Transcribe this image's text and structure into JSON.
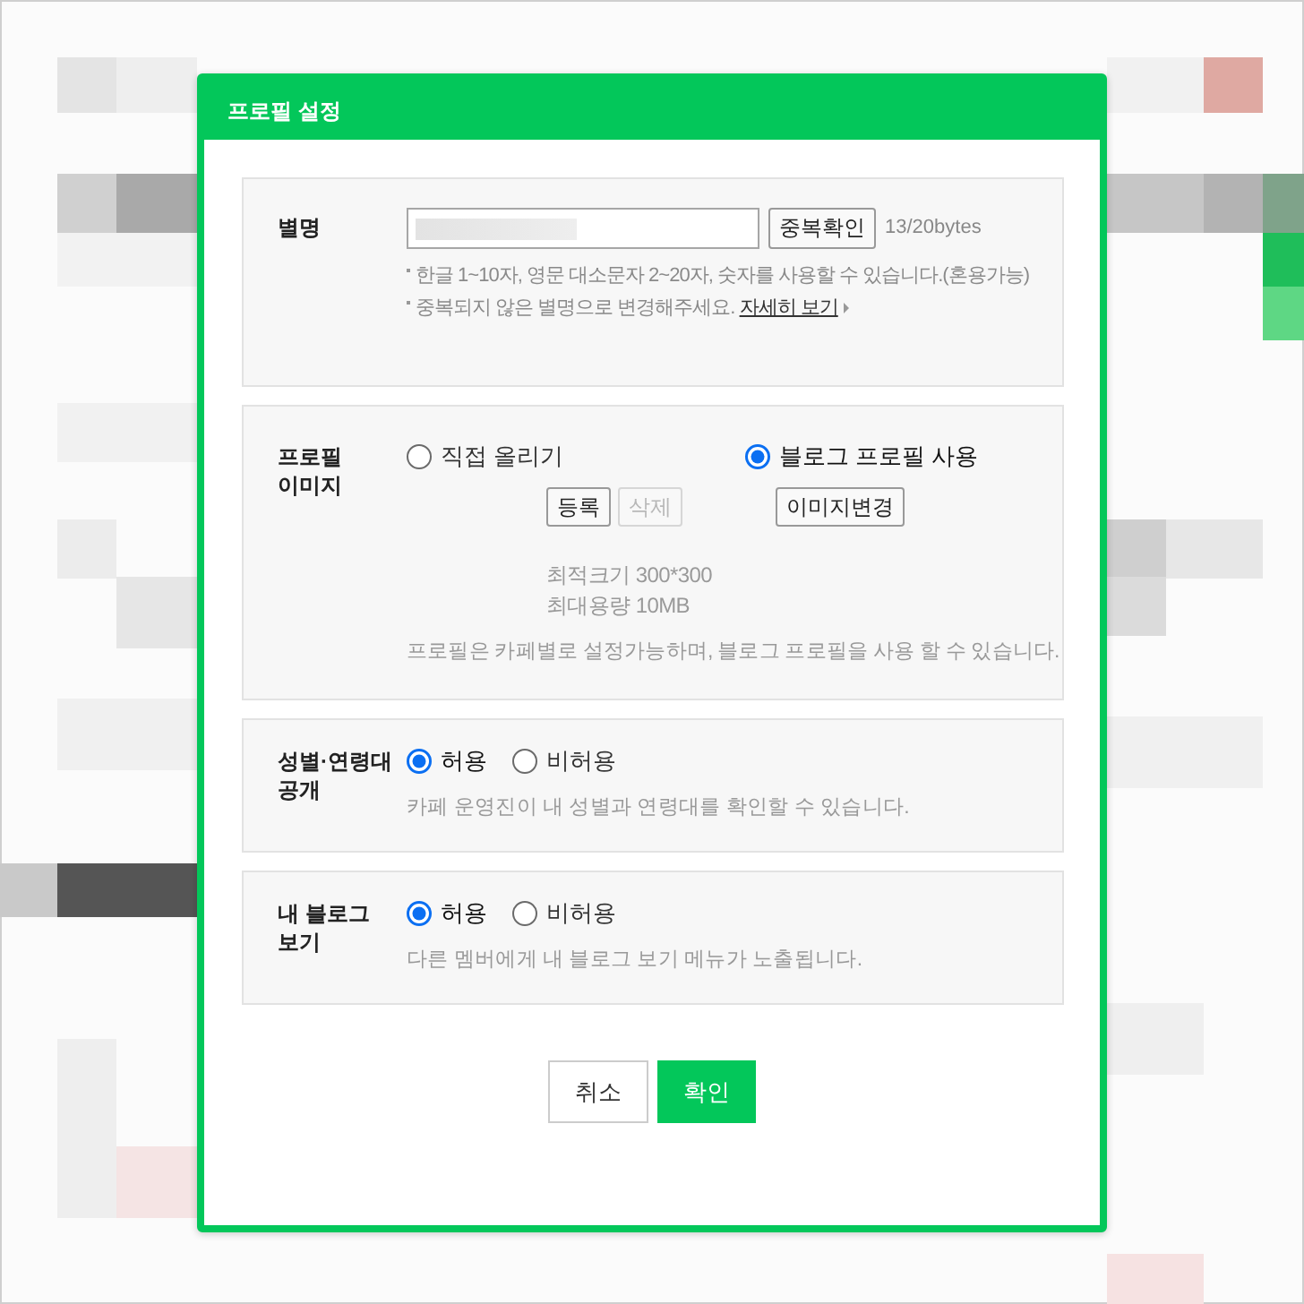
{
  "dialog": {
    "title": "프로필 설정"
  },
  "sections": [
    {
      "kind": "nickname",
      "label": "별명",
      "check_button": "중복확인",
      "byte_count": "13/20bytes",
      "hints": [
        {
          "text": "한글 1~10자, 영문 대소문자 2~20자, 숫자를 사용할 수 있습니다.(혼용가능)"
        },
        {
          "text": "중복되지 않은 별명으로 변경해주세요.",
          "link": "자세히 보기"
        }
      ]
    },
    {
      "kind": "image",
      "label": "프로필 이미지",
      "options": [
        {
          "label": "직접 올리기",
          "selected": false,
          "buttons": [
            {
              "label": "등록",
              "disabled": false
            },
            {
              "label": "삭제",
              "disabled": true
            }
          ],
          "specs": [
            "최적크기 300*300",
            "최대용량 10MB"
          ]
        },
        {
          "label": "블로그 프로필 사용",
          "selected": true,
          "buttons": [
            {
              "label": "이미지변경",
              "disabled": false
            }
          ]
        }
      ],
      "note": "프로필은 카페별로 설정가능하며, 블로그 프로필을 사용 할 수 있습니다."
    },
    {
      "kind": "toggle",
      "label": "성별·연령대 공개",
      "options": [
        {
          "label": "허용",
          "selected": true
        },
        {
          "label": "비허용",
          "selected": false
        }
      ],
      "note": "카페 운영진이 내 성별과 연령대를 확인할 수 있습니다."
    },
    {
      "kind": "toggle",
      "label": "내 블로그 보기",
      "options": [
        {
          "label": "허용",
          "selected": true
        },
        {
          "label": "비허용",
          "selected": false
        }
      ],
      "note": "다른 멤버에게 내 블로그 보기 메뉴가 노출됩니다."
    }
  ],
  "buttons": [
    {
      "label": "취소",
      "kind": "secondary"
    },
    {
      "label": "확인",
      "kind": "primary"
    }
  ]
}
